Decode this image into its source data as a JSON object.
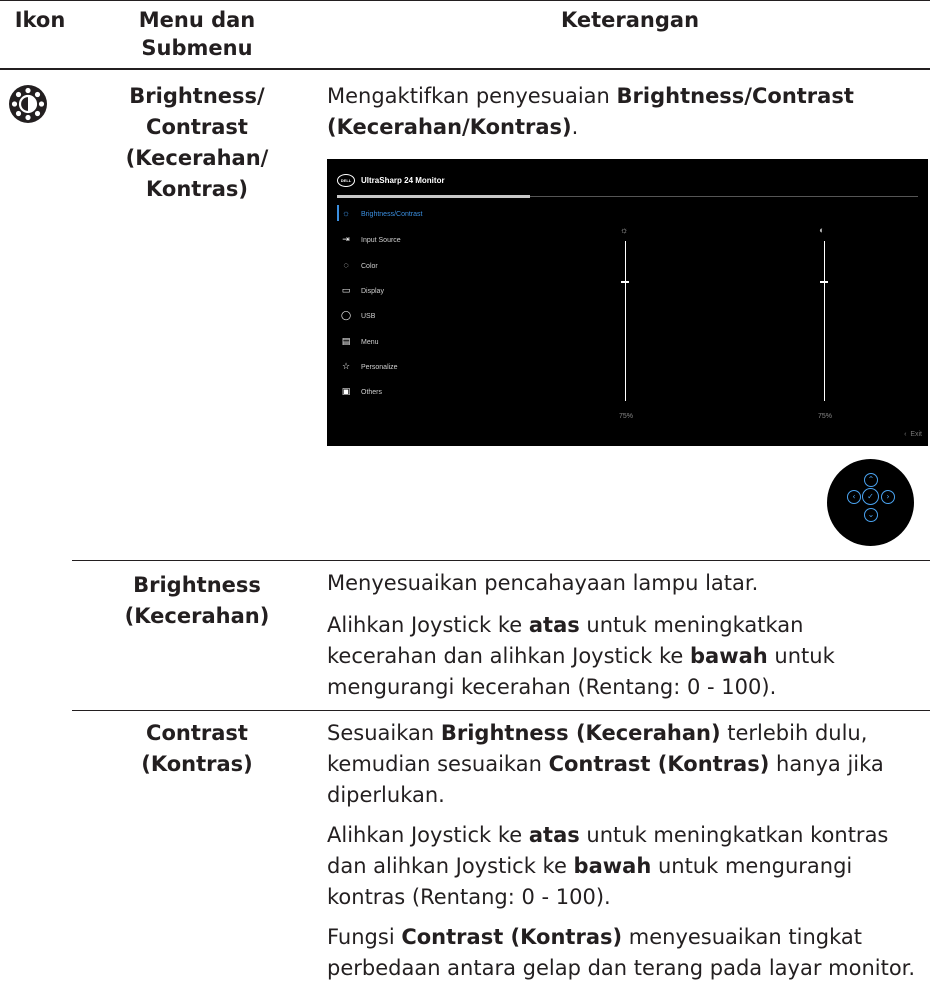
{
  "headers": {
    "icon": "Ikon",
    "menu": "Menu dan\nSubmenu",
    "desc": "Keterangan"
  },
  "row1": {
    "icon": "brightness-contrast-icon",
    "title": "Brightness/\nContrast\n(Kecerahan/\nKontras)",
    "desc_parts": [
      "Mengaktifkan penyesuaian ",
      "Brightness/Contrast (Kecerahan/Kontras)",
      "."
    ]
  },
  "osd": {
    "brand": "DELL",
    "title": "UltraSharp 24 Monitor",
    "menu": [
      {
        "label": "Brightness/Contrast",
        "icon": "sun-icon",
        "active": true
      },
      {
        "label": "Input Source",
        "icon": "input-icon"
      },
      {
        "label": "Color",
        "icon": "palette-icon"
      },
      {
        "label": "Display",
        "icon": "monitor-icon"
      },
      {
        "label": "USB",
        "icon": "usb-icon"
      },
      {
        "label": "Menu",
        "icon": "menu-icon"
      },
      {
        "label": "Personalize",
        "icon": "star-icon"
      },
      {
        "label": "Others",
        "icon": "others-icon"
      }
    ],
    "brightness_pct": "75%",
    "contrast_pct": "75%",
    "brightness_level": 0.75,
    "contrast_level": 0.75,
    "exit": "Exit"
  },
  "row2": {
    "title": "Brightness\n(Kecerahan)",
    "p1": "Menyesuaikan pencahayaan lampu latar.",
    "p2_parts": [
      "Alihkan Joystick ke ",
      "atas",
      " untuk meningkatkan kecerahan dan alihkan Joystick ke ",
      "bawah",
      " untuk mengurangi kecerahan (Rentang: 0 - 100)."
    ]
  },
  "row3": {
    "title": "Contrast\n(Kontras)",
    "p1_parts": [
      "Sesuaikan ",
      "Brightness (Kecerahan)",
      " terlebih dulu, kemudian sesuaikan ",
      "Contrast (Kontras)",
      " hanya jika diperlukan."
    ],
    "p2_parts": [
      "Alihkan Joystick ke ",
      "atas",
      " untuk meningkatkan kontras dan alihkan Joystick ke ",
      "bawah",
      " untuk mengurangi kontras (Rentang: 0 - 100)."
    ],
    "p3_parts": [
      "Fungsi ",
      "Contrast (Kontras)",
      " menyesuaikan tingkat perbedaan antara gelap dan terang pada layar monitor."
    ]
  }
}
